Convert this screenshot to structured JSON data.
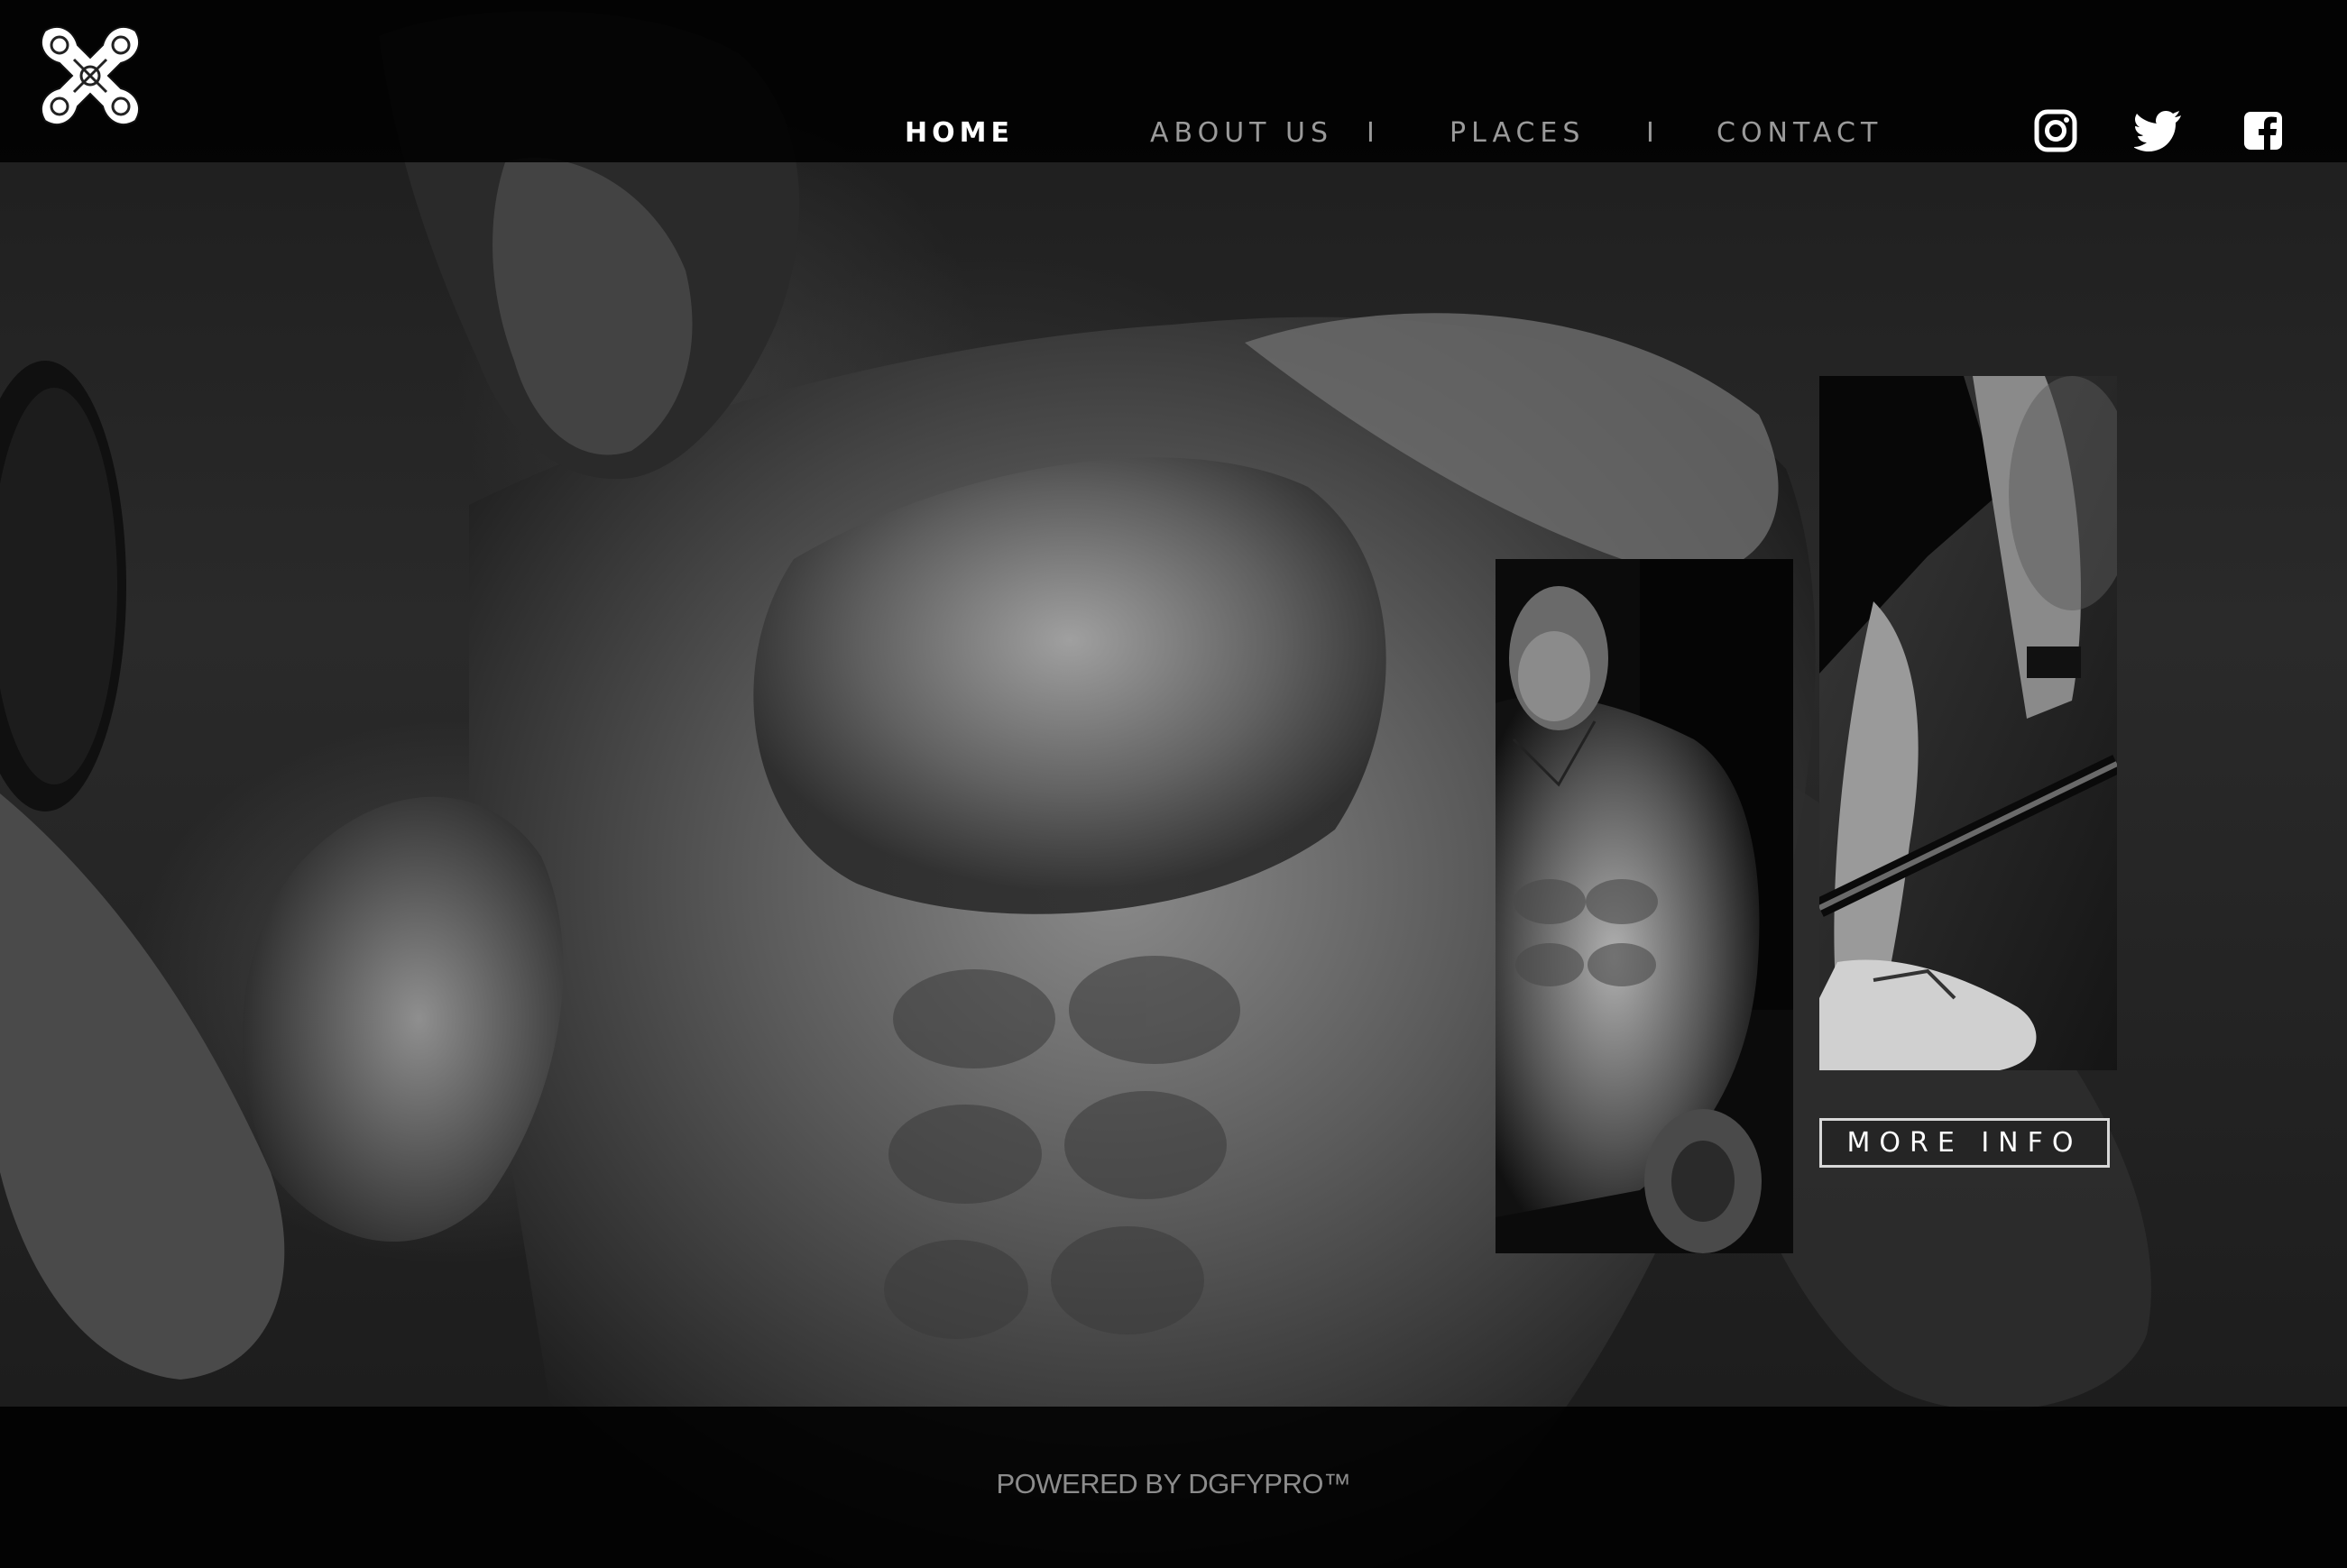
{
  "nav": {
    "items": [
      {
        "label": "HOME",
        "active": true
      },
      {
        "label": "ABOUT US",
        "active": false
      },
      {
        "label": "PLACES",
        "active": false
      },
      {
        "label": "CONTACT",
        "active": false
      }
    ],
    "separator": "I"
  },
  "social": {
    "icons": [
      "instagram-icon",
      "twitter-icon",
      "facebook-icon"
    ]
  },
  "logo": {
    "icon": "puzzle-logo-icon"
  },
  "cta": {
    "more_info_label": "MORE INFO"
  },
  "footer": {
    "text": "POWERED BY DGFYPRO™"
  },
  "colors": {
    "header_bg": "#000000",
    "nav_active": "#ffffff",
    "nav_inactive": "#9a9a9a",
    "footer_text": "#8c8c8c",
    "button_border": "#d8d8d8"
  }
}
